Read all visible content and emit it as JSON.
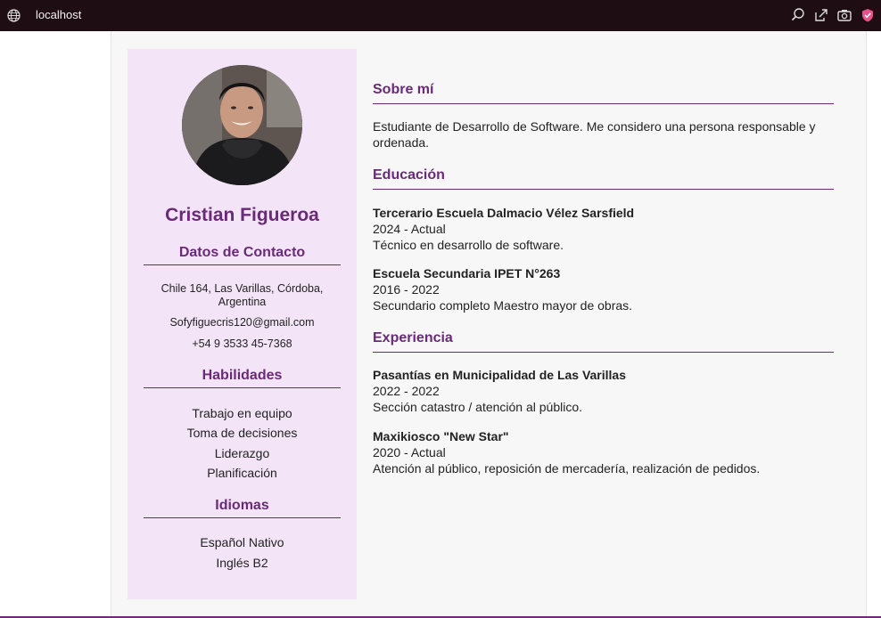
{
  "browser": {
    "url": "localhost",
    "icons": [
      "globe-icon",
      "zoom-icon",
      "share-icon",
      "screenshot-icon",
      "shield-icon"
    ]
  },
  "sidebar": {
    "name": "Cristian Figueroa",
    "contact_heading": "Datos de Contacto",
    "address": "Chile 164, Las Varillas, Córdoba, Argentina",
    "email": "Sofyfiguecris120@gmail.com",
    "phone": "+54 9 3533 45-7368",
    "skills_heading": "Habilidades",
    "skills": [
      "Trabajo en equipo",
      "Toma de decisiones",
      "Liderazgo",
      "Planificación"
    ],
    "languages_heading": "Idiomas",
    "languages": [
      "Español Nativo",
      "Inglés B2"
    ]
  },
  "main": {
    "about": {
      "heading": "Sobre mí",
      "text": "Estudiante de Desarrollo de Software. Me considero una persona responsable y ordenada."
    },
    "education": {
      "heading": "Educación",
      "items": [
        {
          "title": "Tercerario Escuela Dalmacio Vélez Sarsfield",
          "dates": "2024 - Actual",
          "desc": "Técnico en desarrollo de software."
        },
        {
          "title": "Escuela Secundaria IPET N°263",
          "dates": "2016 - 2022",
          "desc": "Secundario completo Maestro mayor de obras."
        }
      ]
    },
    "experience": {
      "heading": "Experiencia",
      "items": [
        {
          "title": "Pasantías en Municipalidad de Las Varillas",
          "dates": "2022 - 2022",
          "desc": "Sección catastro / atención al público."
        },
        {
          "title": "Maxikiosco \"New Star\"",
          "dates": "2020 - Actual",
          "desc": "Atención al público, reposición de mercadería, realización de pedidos."
        }
      ]
    }
  },
  "colors": {
    "accent": "#6a2a78",
    "sidebar_bg": "#f3e5f7",
    "titlebar_bg": "#1f0d14"
  }
}
